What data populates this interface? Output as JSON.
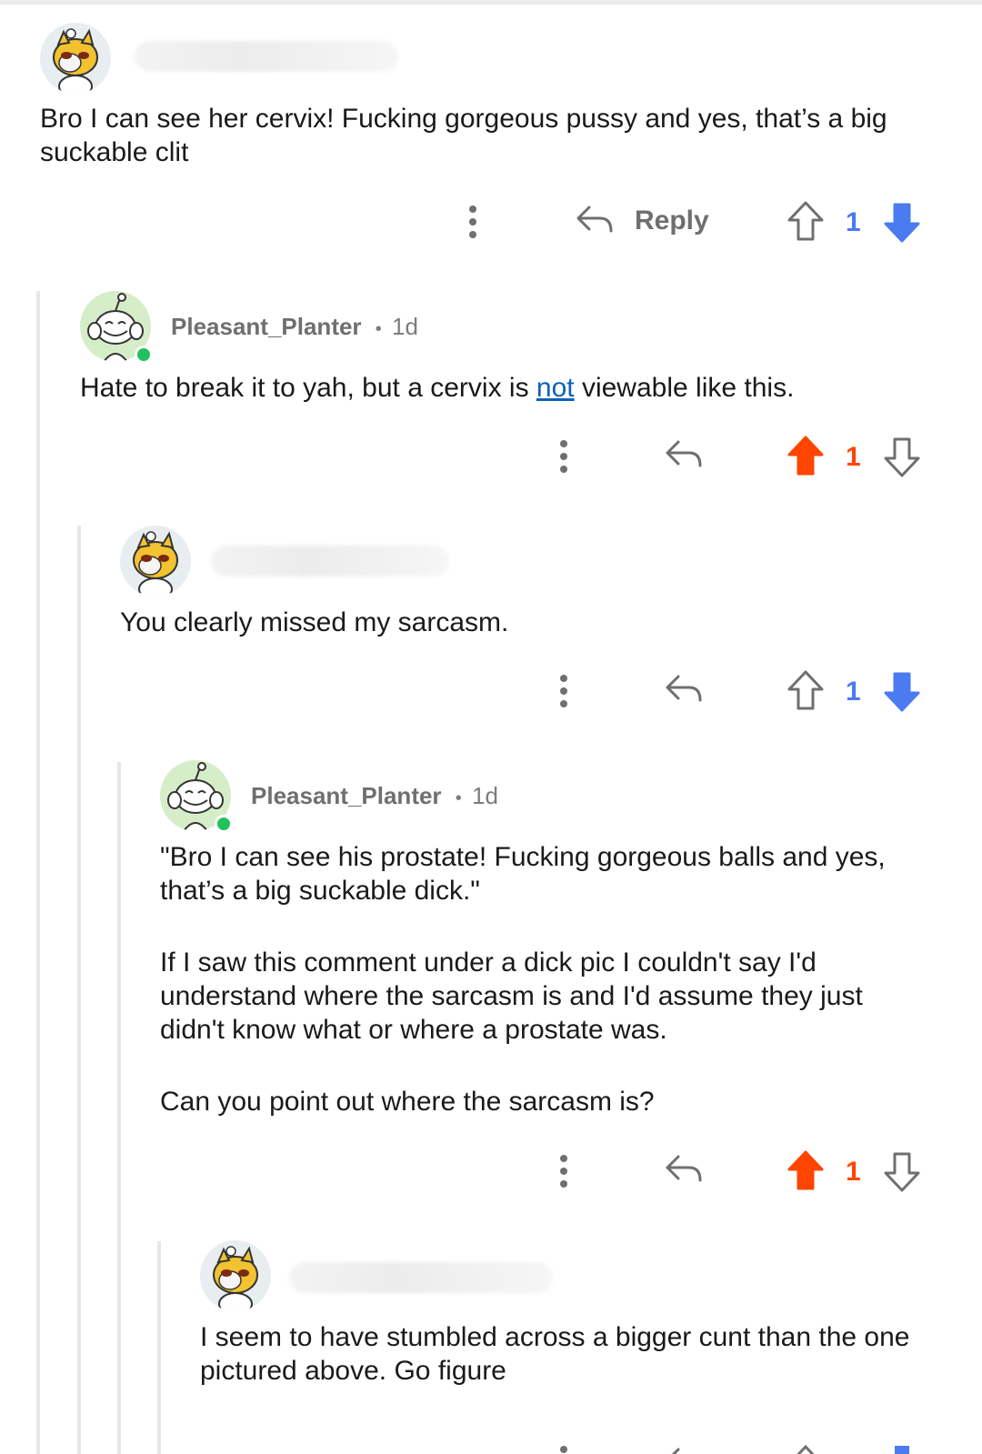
{
  "comments": [
    {
      "username": "",
      "body": [
        "Bro I can see her cervix! Fucking gorgeous pussy and yes, that’s a big suckable clit"
      ],
      "reply_label": "Reply",
      "vote_count": "1",
      "vote_state": "downvoted"
    },
    {
      "username": "Pleasant_Planter",
      "separator": "•",
      "age": "1d",
      "body_parts": {
        "before": "Hate to break it to yah, but a cervix is ",
        "link": "not",
        "after": " viewable like this."
      },
      "vote_count": "1",
      "vote_state": "upvoted"
    },
    {
      "username": "",
      "body": [
        "You clearly missed my sarcasm."
      ],
      "vote_count": "1",
      "vote_state": "downvoted"
    },
    {
      "username": "Pleasant_Planter",
      "separator": "•",
      "age": "1d",
      "body": [
        "\"Bro I can see his prostate! Fucking gorgeous balls and yes, that’s a big suckable dick.\"",
        "If I saw this comment under a dick pic I couldn't say I'd understand where the sarcasm is and I'd assume they just didn't know what or where a prostate was.",
        "Can you point out where the sarcasm is?"
      ],
      "vote_count": "1",
      "vote_state": "upvoted"
    },
    {
      "username": "",
      "body": [
        "I seem to have stumbled across a bigger cunt than the one pictured above. Go figure"
      ]
    }
  ],
  "colors": {
    "upvote": "#ff4500",
    "downvote": "#4a7bf0",
    "icon_gray": "#6f6f6f"
  },
  "icons": [
    "more-vertical-icon",
    "reply-arrow-icon",
    "upvote-arrow-icon",
    "downvote-arrow-icon"
  ]
}
